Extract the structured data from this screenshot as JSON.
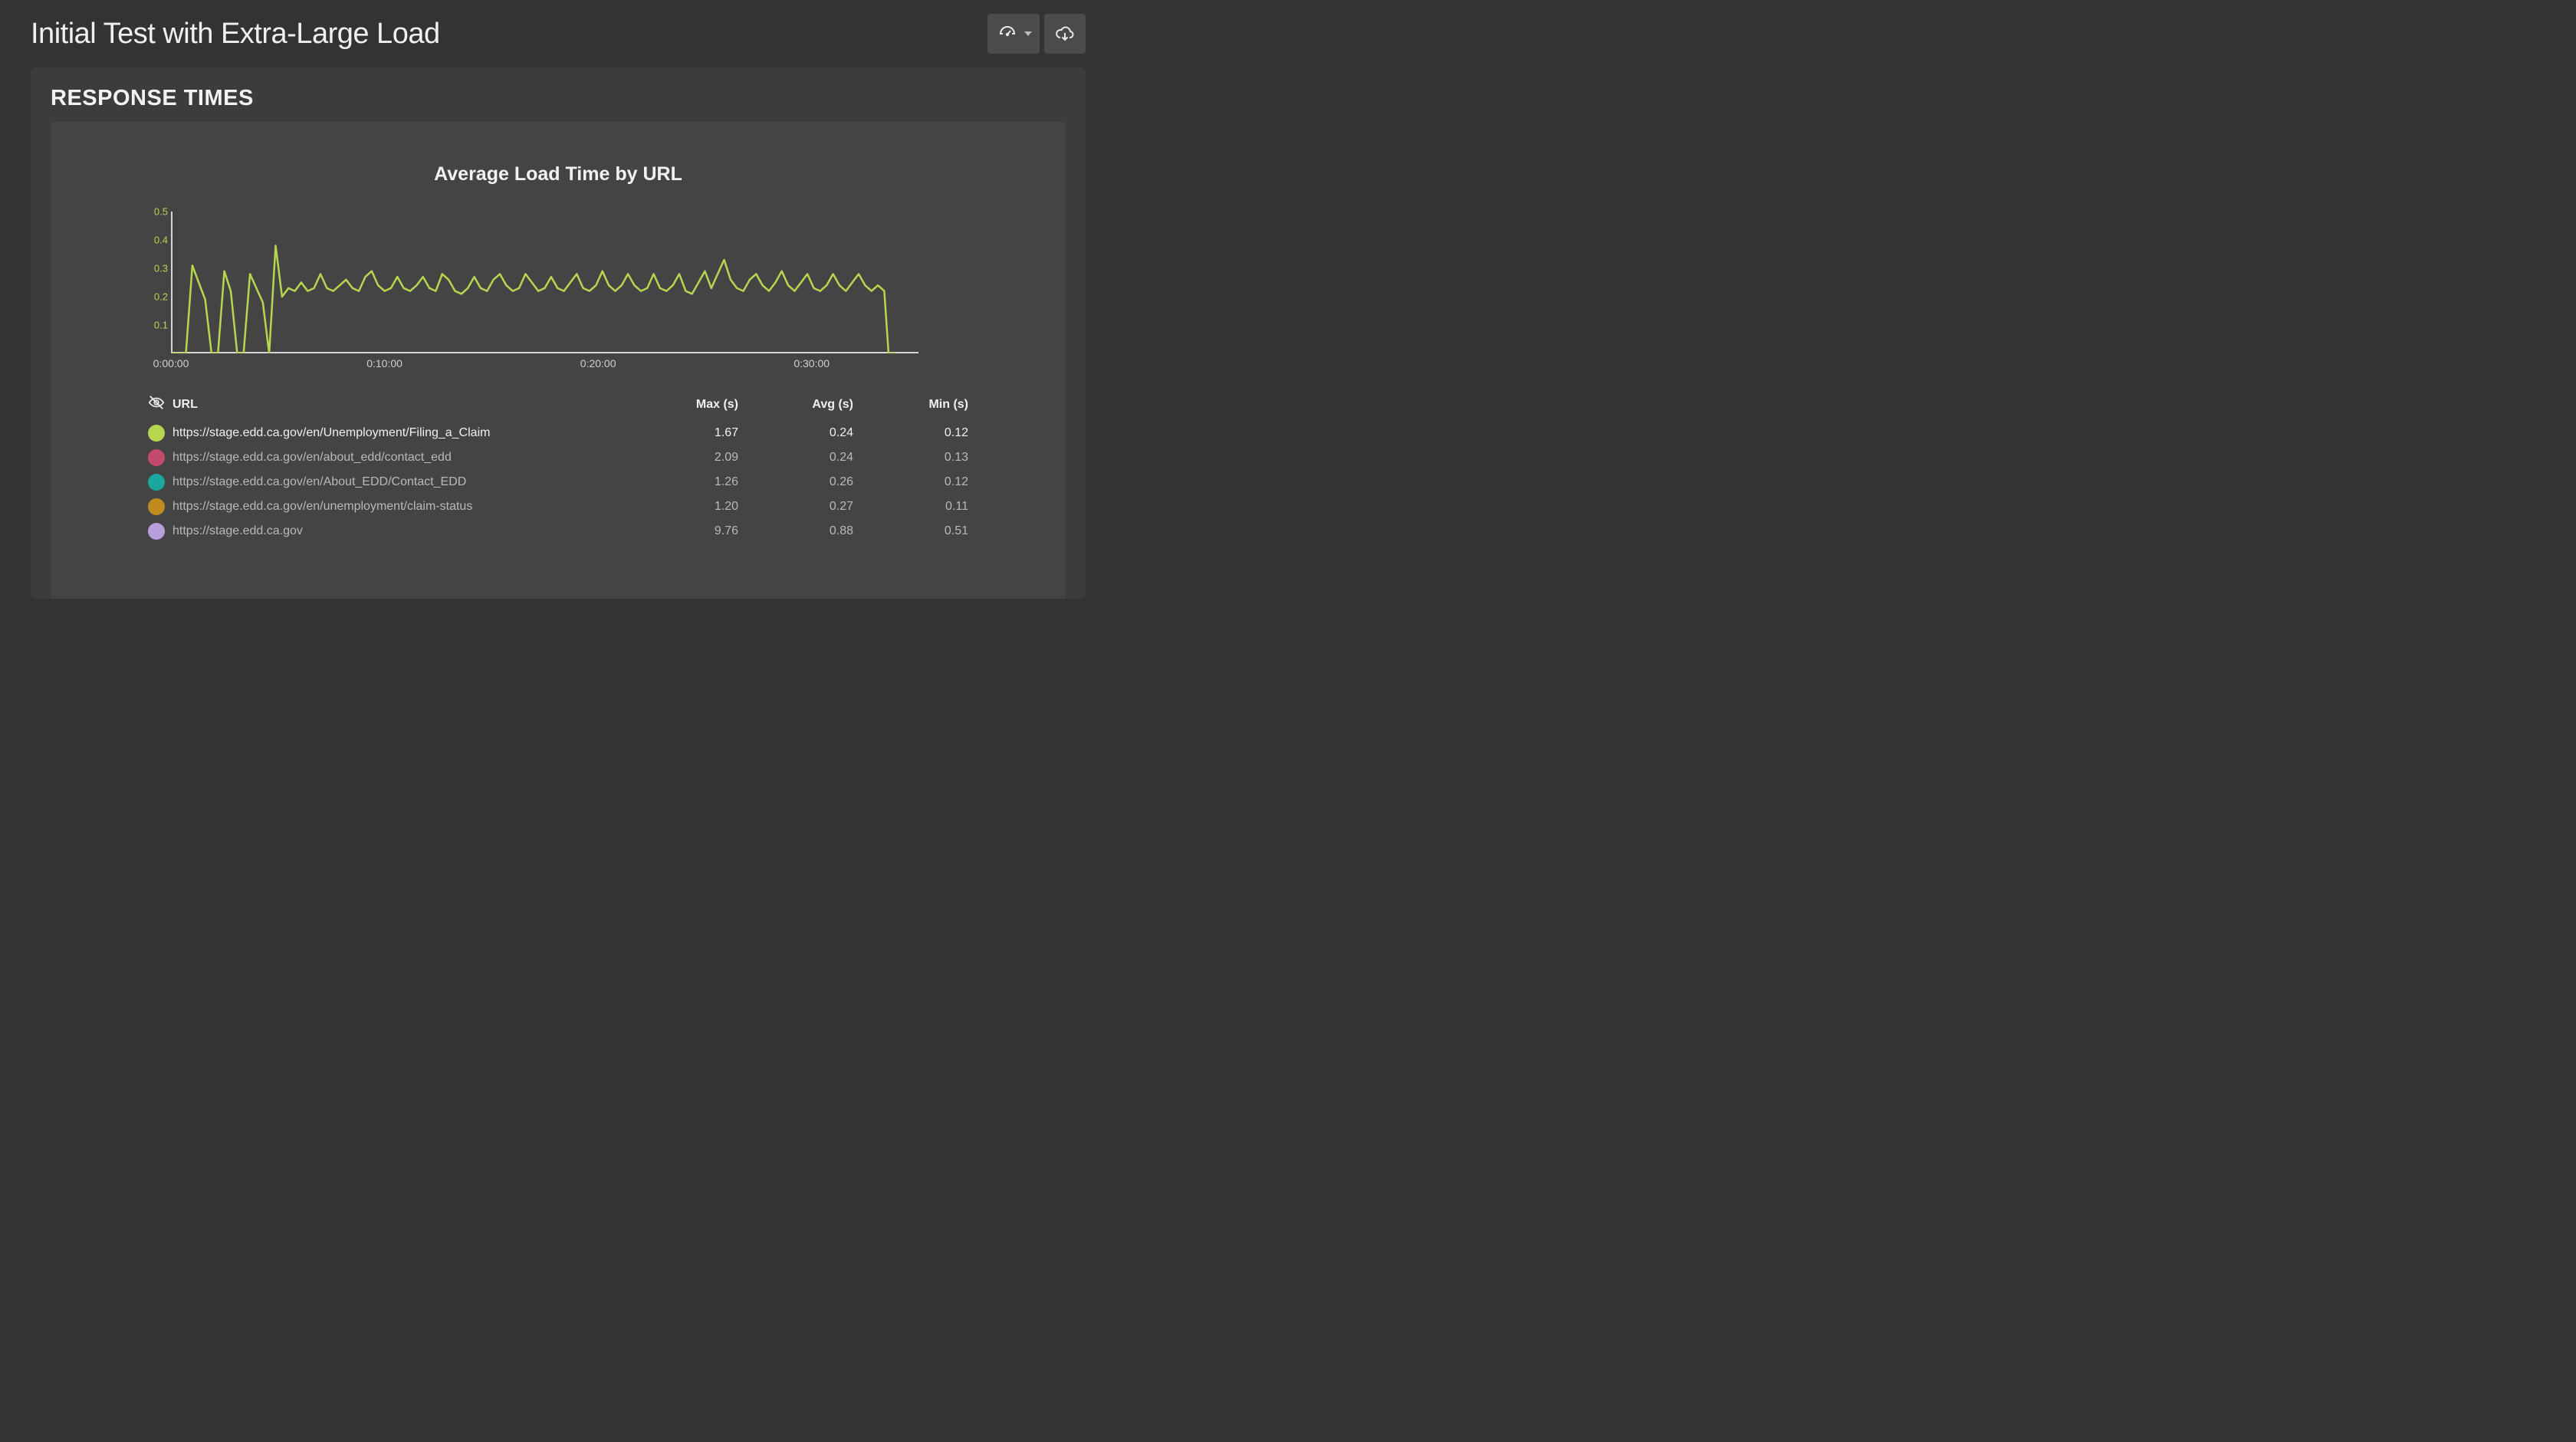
{
  "header": {
    "title": "Initial Test with Extra-Large Load"
  },
  "panel": {
    "title": "RESPONSE TIMES"
  },
  "chart_data": {
    "type": "line",
    "title": "Average Load Time by URL",
    "xlabel": "",
    "ylabel": "",
    "ylim": [
      0,
      0.5
    ],
    "y_ticks": [
      "0.1",
      "0.2",
      "0.3",
      "0.4",
      "0.5"
    ],
    "x_ticks": [
      "0:00:00",
      "0:10:00",
      "0:20:00",
      "0:30:00"
    ],
    "x_range_minutes": [
      0,
      35
    ],
    "series": [
      {
        "name": "https://stage.edd.ca.gov/en/Unemployment/Filing_a_Claim",
        "color": "#b7d64f",
        "points": [
          [
            0.0,
            0.0
          ],
          [
            0.7,
            0.0
          ],
          [
            1.0,
            0.31
          ],
          [
            1.3,
            0.25
          ],
          [
            1.6,
            0.19
          ],
          [
            1.9,
            0.0
          ],
          [
            2.2,
            0.0
          ],
          [
            2.5,
            0.29
          ],
          [
            2.8,
            0.22
          ],
          [
            3.1,
            0.0
          ],
          [
            3.4,
            0.0
          ],
          [
            3.7,
            0.28
          ],
          [
            4.0,
            0.23
          ],
          [
            4.3,
            0.18
          ],
          [
            4.6,
            0.0
          ],
          [
            4.9,
            0.38
          ],
          [
            5.2,
            0.2
          ],
          [
            5.5,
            0.23
          ],
          [
            5.8,
            0.22
          ],
          [
            6.1,
            0.25
          ],
          [
            6.4,
            0.22
          ],
          [
            6.7,
            0.23
          ],
          [
            7.0,
            0.28
          ],
          [
            7.3,
            0.23
          ],
          [
            7.6,
            0.22
          ],
          [
            7.9,
            0.24
          ],
          [
            8.2,
            0.26
          ],
          [
            8.5,
            0.23
          ],
          [
            8.8,
            0.22
          ],
          [
            9.1,
            0.27
          ],
          [
            9.4,
            0.29
          ],
          [
            9.7,
            0.24
          ],
          [
            10.0,
            0.22
          ],
          [
            10.3,
            0.23
          ],
          [
            10.6,
            0.27
          ],
          [
            10.9,
            0.23
          ],
          [
            11.2,
            0.22
          ],
          [
            11.5,
            0.24
          ],
          [
            11.8,
            0.27
          ],
          [
            12.1,
            0.23
          ],
          [
            12.4,
            0.22
          ],
          [
            12.7,
            0.28
          ],
          [
            13.0,
            0.26
          ],
          [
            13.3,
            0.22
          ],
          [
            13.6,
            0.21
          ],
          [
            13.9,
            0.23
          ],
          [
            14.2,
            0.27
          ],
          [
            14.5,
            0.23
          ],
          [
            14.8,
            0.22
          ],
          [
            15.1,
            0.26
          ],
          [
            15.4,
            0.28
          ],
          [
            15.7,
            0.24
          ],
          [
            16.0,
            0.22
          ],
          [
            16.3,
            0.23
          ],
          [
            16.6,
            0.28
          ],
          [
            16.9,
            0.25
          ],
          [
            17.2,
            0.22
          ],
          [
            17.5,
            0.23
          ],
          [
            17.8,
            0.27
          ],
          [
            18.1,
            0.23
          ],
          [
            18.4,
            0.22
          ],
          [
            18.7,
            0.25
          ],
          [
            19.0,
            0.28
          ],
          [
            19.3,
            0.23
          ],
          [
            19.6,
            0.22
          ],
          [
            19.9,
            0.24
          ],
          [
            20.2,
            0.29
          ],
          [
            20.5,
            0.24
          ],
          [
            20.8,
            0.22
          ],
          [
            21.1,
            0.24
          ],
          [
            21.4,
            0.28
          ],
          [
            21.7,
            0.24
          ],
          [
            22.0,
            0.22
          ],
          [
            22.3,
            0.23
          ],
          [
            22.6,
            0.28
          ],
          [
            22.9,
            0.23
          ],
          [
            23.2,
            0.22
          ],
          [
            23.5,
            0.24
          ],
          [
            23.8,
            0.28
          ],
          [
            24.1,
            0.22
          ],
          [
            24.4,
            0.21
          ],
          [
            24.7,
            0.25
          ],
          [
            25.0,
            0.29
          ],
          [
            25.3,
            0.23
          ],
          [
            25.6,
            0.28
          ],
          [
            25.9,
            0.33
          ],
          [
            26.2,
            0.26
          ],
          [
            26.5,
            0.23
          ],
          [
            26.8,
            0.22
          ],
          [
            27.1,
            0.26
          ],
          [
            27.4,
            0.28
          ],
          [
            27.7,
            0.24
          ],
          [
            28.0,
            0.22
          ],
          [
            28.3,
            0.25
          ],
          [
            28.6,
            0.29
          ],
          [
            28.9,
            0.24
          ],
          [
            29.2,
            0.22
          ],
          [
            29.5,
            0.25
          ],
          [
            29.8,
            0.28
          ],
          [
            30.1,
            0.23
          ],
          [
            30.4,
            0.22
          ],
          [
            30.7,
            0.24
          ],
          [
            31.0,
            0.28
          ],
          [
            31.3,
            0.24
          ],
          [
            31.6,
            0.22
          ],
          [
            31.9,
            0.25
          ],
          [
            32.2,
            0.28
          ],
          [
            32.5,
            0.24
          ],
          [
            32.8,
            0.22
          ],
          [
            33.1,
            0.24
          ],
          [
            33.4,
            0.22
          ],
          [
            33.6,
            0.0
          ],
          [
            33.9,
            0.0
          ]
        ]
      }
    ]
  },
  "table": {
    "headers": {
      "url": "URL",
      "max": "Max (s)",
      "avg": "Avg (s)",
      "min": "Min (s)"
    },
    "rows": [
      {
        "color": "#b7d64f",
        "url": "https://stage.edd.ca.gov/en/Unemployment/Filing_a_Claim",
        "max": "1.67",
        "avg": "0.24",
        "min": "0.12",
        "active": true
      },
      {
        "color": "#c24a6b",
        "url": "https://stage.edd.ca.gov/en/about_edd/contact_edd",
        "max": "2.09",
        "avg": "0.24",
        "min": "0.13",
        "active": false
      },
      {
        "color": "#1aa79c",
        "url": "https://stage.edd.ca.gov/en/About_EDD/Contact_EDD",
        "max": "1.26",
        "avg": "0.26",
        "min": "0.12",
        "active": false
      },
      {
        "color": "#c08a1e",
        "url": "https://stage.edd.ca.gov/en/unemployment/claim-status",
        "max": "1.20",
        "avg": "0.27",
        "min": "0.11",
        "active": false
      },
      {
        "color": "#b89edb",
        "url": "https://stage.edd.ca.gov",
        "max": "9.76",
        "avg": "0.88",
        "min": "0.51",
        "active": false
      }
    ]
  }
}
